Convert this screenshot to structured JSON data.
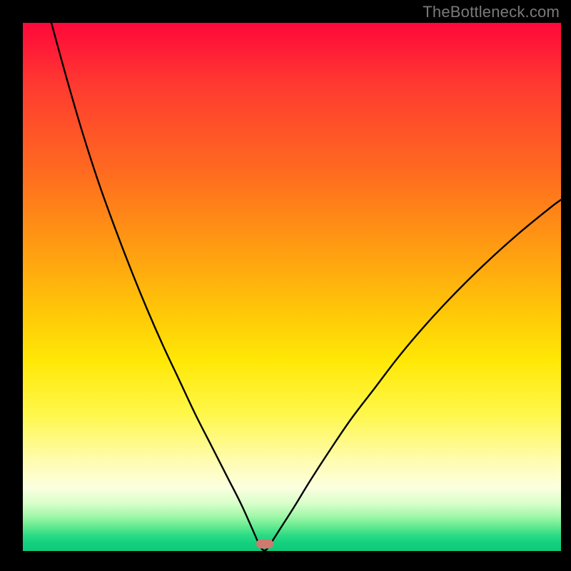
{
  "watermark": "TheBottleneck.com",
  "pill": {
    "x_frac": 0.449,
    "y_frac": 0.987,
    "color": "#cf7a6f"
  },
  "chart_data": {
    "type": "line",
    "title": "",
    "xlabel": "",
    "ylabel": "",
    "xlim": [
      0,
      100
    ],
    "ylim": [
      0,
      100
    ],
    "grid": false,
    "legend": false,
    "annotations": [
      "TheBottleneck.com"
    ],
    "notes": "Single V-shaped black curve over a vertical heat gradient (red→yellow→green). Minimum of the curve touches y≈0 around x≈45 where a small rounded pink pill marker sits. Axes are unlabeled; values estimated from pixel geometry (0–100 normalized).",
    "pill_marker": {
      "x": 44.9,
      "y": 0.0
    },
    "series": [
      {
        "name": "left-branch",
        "x": [
          5.3,
          8.0,
          11.0,
          14.0,
          17.0,
          20.0,
          23.0,
          26.0,
          29.0,
          32.0,
          35.0,
          38.0,
          40.5,
          42.5,
          43.8,
          44.5
        ],
        "y": [
          100.0,
          90.0,
          79.5,
          70.0,
          61.5,
          53.5,
          46.0,
          39.0,
          32.5,
          26.0,
          20.0,
          14.0,
          9.0,
          4.5,
          1.5,
          0.3
        ]
      },
      {
        "name": "right-branch",
        "x": [
          45.3,
          46.3,
          48.0,
          50.5,
          53.5,
          57.0,
          61.0,
          65.5,
          70.0,
          75.0,
          80.5,
          86.0,
          92.0,
          98.0,
          100.0
        ],
        "y": [
          0.3,
          1.8,
          4.5,
          8.5,
          13.5,
          19.0,
          25.0,
          31.0,
          37.0,
          43.0,
          49.0,
          54.5,
          60.0,
          65.0,
          66.5
        ]
      }
    ]
  }
}
